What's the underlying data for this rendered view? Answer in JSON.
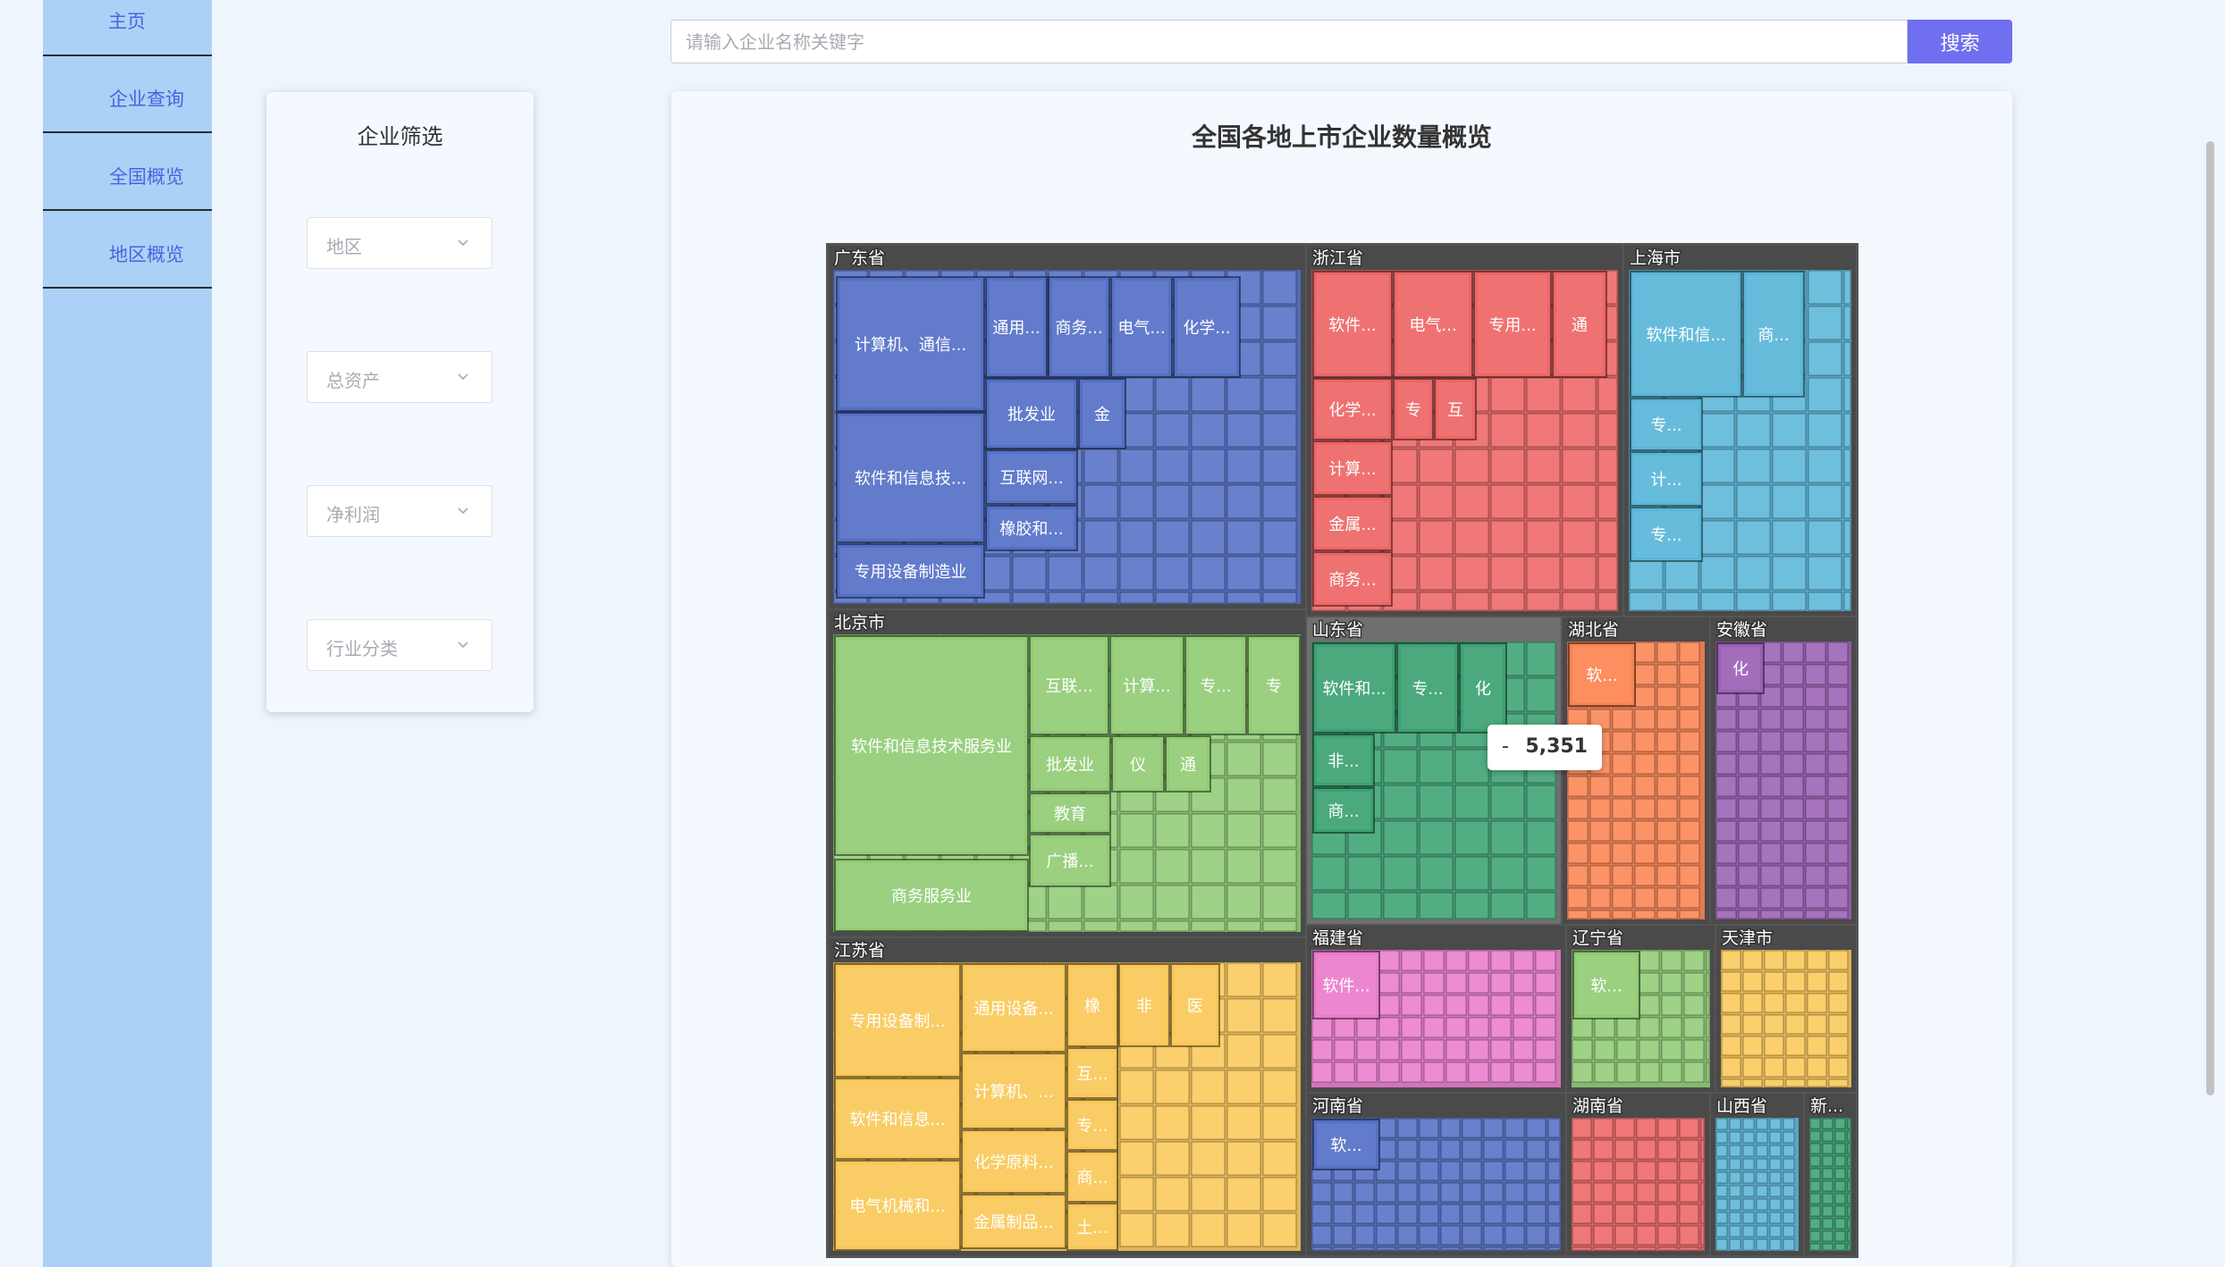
{
  "nav": {
    "items": [
      "主页",
      "企业查询",
      "全国概览",
      "地区概览"
    ]
  },
  "filter": {
    "title": "企业筛选",
    "selects": [
      "地区",
      "总资产",
      "净利润",
      "行业分类"
    ]
  },
  "search": {
    "placeholder": "请输入企业名称关键字",
    "button_label": "搜索"
  },
  "tooltip": {
    "name": "-",
    "value": "5,351"
  },
  "chart_data": {
    "type": "treemap",
    "title": "全国各地上市企业数量概览",
    "regions": [
      {
        "name": "广东省",
        "color": "#5470c6",
        "labels": [
          "计算机、通信...",
          "通用...",
          "商务...",
          "电气...",
          "化学...",
          "软件和信息技...",
          "批发业",
          "金",
          "互联网...",
          "橡胶和...",
          "专用设备制造业"
        ]
      },
      {
        "name": "浙江省",
        "color": "#ee6666",
        "labels": [
          "软件...",
          "电气...",
          "专用...",
          "通",
          "化学...",
          "专",
          "互",
          "计算...",
          "金属...",
          "商务..."
        ]
      },
      {
        "name": "上海市",
        "color": "#5ab6d8",
        "labels": [
          "软件和信...",
          "商...",
          "专...",
          "计...",
          "专..."
        ]
      },
      {
        "name": "北京市",
        "color": "#91cc75",
        "labels": [
          "软件和信息技术服务业",
          "互联...",
          "计算...",
          "专...",
          "专",
          "批发业",
          "仪",
          "通",
          "教育",
          "广播...",
          "商务服务业"
        ]
      },
      {
        "name": "山东省",
        "color": "#3ba272",
        "labels": [
          "软件和...",
          "专...",
          "化",
          "非...",
          "商..."
        ]
      },
      {
        "name": "湖北省",
        "color": "#fc8452",
        "labels": [
          "软..."
        ]
      },
      {
        "name": "安徽省",
        "color": "#9a60b4",
        "labels": [
          "化"
        ]
      },
      {
        "name": "江苏省",
        "color": "#fac858",
        "labels": [
          "专用设备制...",
          "通用设备...",
          "橡",
          "非",
          "医",
          "软件和信息...",
          "计算机、...",
          "互...",
          "专...",
          "化学原料...",
          "电气机械和...",
          "商...",
          "金属制品...",
          "土..."
        ]
      },
      {
        "name": "福建省",
        "color": "#ea7ccc",
        "labels": [
          "软件..."
        ]
      },
      {
        "name": "辽宁省",
        "color": "#91cc75",
        "labels": [
          "软..."
        ]
      },
      {
        "name": "天津市",
        "color": "#fac858",
        "labels": []
      },
      {
        "name": "河南省",
        "color": "#5470c6",
        "labels": [
          "软..."
        ]
      },
      {
        "name": "湖南省",
        "color": "#ee6666",
        "labels": []
      },
      {
        "name": "山西省",
        "color": "#5ab6d8",
        "labels": []
      },
      {
        "name": "新...",
        "color": "#3ba272",
        "labels": []
      }
    ]
  }
}
